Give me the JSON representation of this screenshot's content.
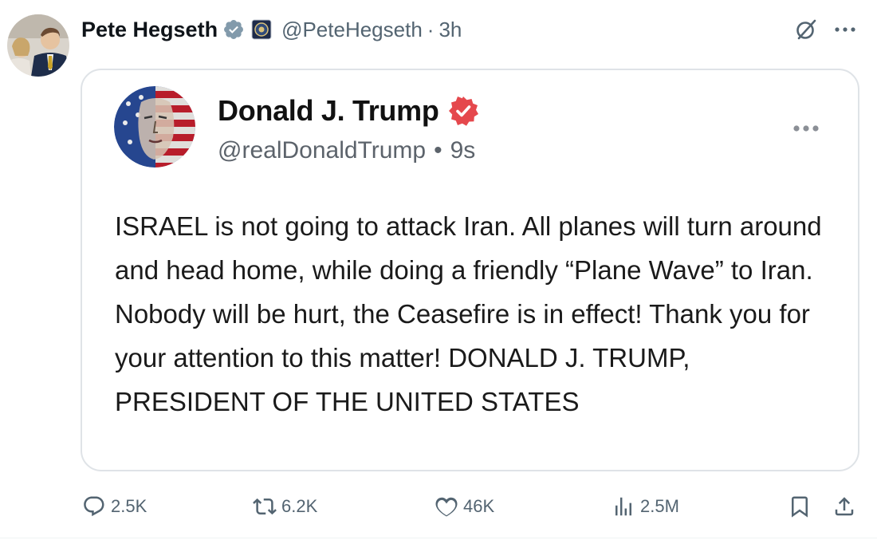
{
  "post": {
    "author_name": "Pete Hegseth",
    "author_handle": "@PeteHegseth",
    "separator": "·",
    "time": "3h"
  },
  "quoted": {
    "author_name": "Donald J. Trump",
    "author_handle": "@realDonaldTrump",
    "separator": "•",
    "time": "9s",
    "body": "ISRAEL is not going to attack Iran. All planes will turn around and head home, while doing a friendly “Plane Wave” to Iran. Nobody will be hurt, the Ceasefire is in effect! Thank you for your attention to this matter! DONALD J. TRUMP, PRESIDENT OF THE UNITED STATES"
  },
  "actions": {
    "replies": "2.5K",
    "reposts": "6.2K",
    "likes": "46K",
    "views": "2.5M"
  },
  "icons": {
    "verified_badge": "verified-badge-icon",
    "affiliate_badge": "dod-affiliate-icon",
    "grok": "grok-icon",
    "more": "more-horizontal-icon",
    "truth_verified": "truth-verified-icon",
    "reply": "reply-icon",
    "repost": "repost-icon",
    "like": "heart-icon",
    "views": "views-icon",
    "bookmark": "bookmark-icon",
    "share": "share-icon"
  },
  "colors": {
    "text_primary": "#0f1419",
    "text_secondary": "#536471",
    "verified_gray": "#829aab",
    "truth_red": "#e5484d",
    "card_border": "#dfe3e7"
  }
}
